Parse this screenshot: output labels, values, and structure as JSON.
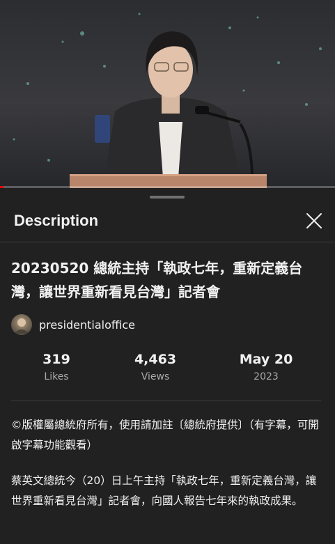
{
  "player": {
    "progress_fraction": 0.01,
    "progress_color": "#ff0000"
  },
  "description_sheet": {
    "header": {
      "title": "Description",
      "close_icon": "close-icon"
    },
    "video_title": "20230520 總統主持「執政七年，重新定義台灣，讓世界重新看見台灣」記者會",
    "channel": {
      "name": "presidentialoffice",
      "avatar_icon": "channel-avatar"
    },
    "stats": [
      {
        "value": "319",
        "label": "Likes"
      },
      {
        "value": "4,463",
        "label": "Views"
      },
      {
        "value": "May 20",
        "label": "2023"
      }
    ],
    "description": [
      "©版權屬總統府所有，使用請加註〔總統府提供〕（有字幕，可開啟字幕功能觀看）",
      "蔡英文總統今（20）日上午主持「執政七年，重新定義台灣，讓世界重新看見台灣」記者會，向國人報告七年來的執政成果。"
    ]
  },
  "colors": {
    "sheet_background": "#212121",
    "text_primary": "#f1f1f1",
    "text_secondary": "#aaaaaa",
    "accent_red": "#ff0000"
  }
}
